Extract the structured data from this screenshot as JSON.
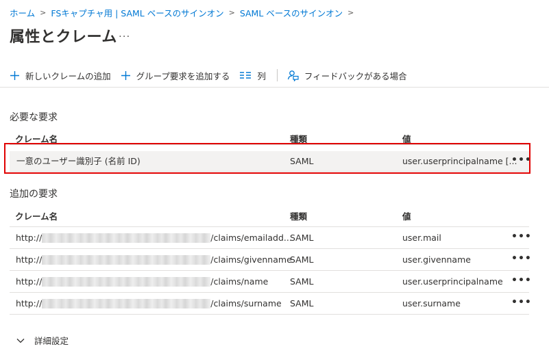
{
  "breadcrumb": {
    "items": [
      "ホーム",
      "FSキャプチャ用 | SAML ベースのサインオン",
      "SAML ベースのサインオン"
    ]
  },
  "page": {
    "title": "属性とクレーム",
    "more_label": "..."
  },
  "toolbar": {
    "add_claim": "新しいクレームの追加",
    "add_group_claim": "グループ要求を追加する",
    "columns": "列",
    "feedback": "フィードバックがある場合"
  },
  "required": {
    "heading": "必要な要求",
    "headers": [
      "クレーム名",
      "種類",
      "値"
    ],
    "rows": [
      {
        "name": "一意のユーザー識別子 (名前 ID)",
        "type": "SAML",
        "value": "user.userprincipalname [..."
      }
    ]
  },
  "additional": {
    "heading": "追加の要求",
    "headers": [
      "クレーム名",
      "種類",
      "値"
    ],
    "rows": [
      {
        "name_prefix": "http://",
        "name_suffix": "/claims/emailadd...",
        "type": "SAML",
        "value": "user.mail"
      },
      {
        "name_prefix": "http://",
        "name_suffix": "/claims/givenname",
        "type": "SAML",
        "value": "user.givenname"
      },
      {
        "name_prefix": "http://",
        "name_suffix": "/claims/name",
        "type": "SAML",
        "value": "user.userprincipalname"
      },
      {
        "name_prefix": "http://",
        "name_suffix": "/claims/surname",
        "type": "SAML",
        "value": "user.surname"
      }
    ]
  },
  "advanced": {
    "label": "詳細設定"
  },
  "colors": {
    "accent": "#0078d4",
    "highlight": "#e00000",
    "selected_row": "#f3f2f1"
  }
}
